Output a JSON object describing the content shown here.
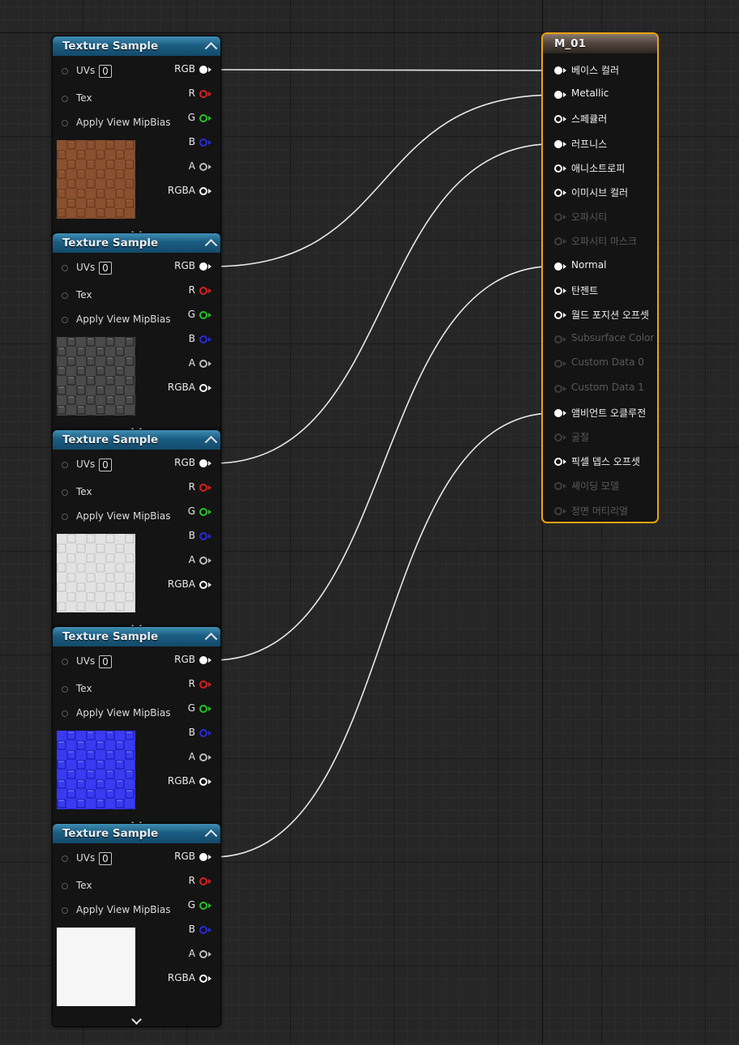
{
  "texture_nodes": [
    {
      "title": "Texture Sample",
      "uvs_label": "UVs",
      "uvs_value": "0",
      "tex_label": "Tex",
      "mip_label": "Apply View MipBias",
      "thumbnail": "brick-brown",
      "outputs": [
        "RGB",
        "R",
        "G",
        "B",
        "A",
        "RGBA"
      ]
    },
    {
      "title": "Texture Sample",
      "uvs_label": "UVs",
      "uvs_value": "0",
      "tex_label": "Tex",
      "mip_label": "Apply View MipBias",
      "thumbnail": "brick-gray-metallic",
      "outputs": [
        "RGB",
        "R",
        "G",
        "B",
        "A",
        "RGBA"
      ]
    },
    {
      "title": "Texture Sample",
      "uvs_label": "UVs",
      "uvs_value": "0",
      "tex_label": "Tex",
      "mip_label": "Apply View MipBias",
      "thumbnail": "brick-white-roughness",
      "outputs": [
        "RGB",
        "R",
        "G",
        "B",
        "A",
        "RGBA"
      ]
    },
    {
      "title": "Texture Sample",
      "uvs_label": "UVs",
      "uvs_value": "0",
      "tex_label": "Tex",
      "mip_label": "Apply View MipBias",
      "thumbnail": "brick-normal-blue",
      "outputs": [
        "RGB",
        "R",
        "G",
        "B",
        "A",
        "RGBA"
      ]
    },
    {
      "title": "Texture Sample",
      "uvs_label": "UVs",
      "uvs_value": "0",
      "tex_label": "Tex",
      "mip_label": "Apply View MipBias",
      "thumbnail": "white-ao",
      "outputs": [
        "RGB",
        "R",
        "G",
        "B",
        "A",
        "RGBA"
      ]
    }
  ],
  "output_pin_colors": {
    "RGB": "#ffffff",
    "R": "#d81f1f",
    "G": "#22c422",
    "B": "#2a2ad8",
    "A": "#bdbdbd",
    "RGBA": "#ffffff"
  },
  "material_node": {
    "title": "M_01",
    "border_color": "#f0a211",
    "inputs": [
      {
        "label": "베이스 컬러",
        "state": "connected"
      },
      {
        "label": "Metallic",
        "state": "connected"
      },
      {
        "label": "스페큘러",
        "state": "enabled"
      },
      {
        "label": "러프니스",
        "state": "connected"
      },
      {
        "label": "애니소트로피",
        "state": "enabled"
      },
      {
        "label": "이미시브 컬러",
        "state": "enabled"
      },
      {
        "label": "오파시티",
        "state": "disabled"
      },
      {
        "label": "오파시티 마스크",
        "state": "disabled"
      },
      {
        "label": "Normal",
        "state": "connected"
      },
      {
        "label": "탄젠트",
        "state": "enabled"
      },
      {
        "label": "월드 포지션 오프셋",
        "state": "enabled"
      },
      {
        "label": "Subsurface Color",
        "state": "disabled"
      },
      {
        "label": "Custom Data 0",
        "state": "disabled"
      },
      {
        "label": "Custom Data 1",
        "state": "disabled"
      },
      {
        "label": "앰비언트 오클루전",
        "state": "connected"
      },
      {
        "label": "굴절",
        "state": "disabled"
      },
      {
        "label": "픽셀 뎁스 오프셋",
        "state": "enabled"
      },
      {
        "label": "셰이딩 모델",
        "state": "disabled"
      },
      {
        "label": "정면 머티리얼",
        "state": "disabled"
      }
    ]
  },
  "connections": [
    {
      "from_node": 0,
      "from_pin": "RGB",
      "to_input": "베이스 컬러"
    },
    {
      "from_node": 1,
      "from_pin": "RGB",
      "to_input": "Metallic"
    },
    {
      "from_node": 2,
      "from_pin": "RGB",
      "to_input": "러프니스"
    },
    {
      "from_node": 3,
      "from_pin": "RGB",
      "to_input": "Normal"
    },
    {
      "from_node": 4,
      "from_pin": "RGB",
      "to_input": "앰비언트 오클루전"
    }
  ]
}
